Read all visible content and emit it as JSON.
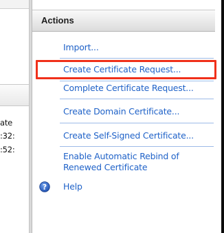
{
  "left_pane": {
    "column_header": "",
    "rows": [
      "ate",
      ":32:",
      ":52:"
    ]
  },
  "actions": {
    "title": "Actions",
    "items": [
      {
        "label": "Import..."
      },
      {
        "label": "Create Certificate Request..."
      },
      {
        "label": "Complete Certificate Request..."
      },
      {
        "label": "Create Domain Certificate..."
      },
      {
        "label": "Create Self-Signed Certificate..."
      },
      {
        "label": "Enable Automatic Rebind of Renewed Certificate"
      },
      {
        "label": "Help",
        "icon": "help-icon"
      }
    ],
    "highlighted_item": "Create Certificate Request...",
    "highlight_color": "#f0301a",
    "link_color": "#1f62c8"
  }
}
